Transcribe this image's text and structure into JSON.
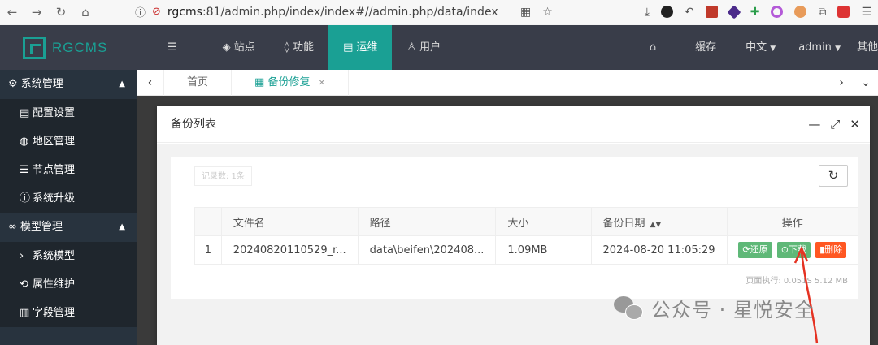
{
  "browser": {
    "url_prefix": "rgcms",
    "url_rest": ":81/admin.php/index/index#//admin.php/data/index"
  },
  "header": {
    "logo": "RGCMS",
    "menu": [
      {
        "icon": "layers-icon",
        "label": "站点",
        "active": false
      },
      {
        "icon": "drop-icon",
        "label": "功能",
        "active": false
      },
      {
        "icon": "ops-icon",
        "label": "运维",
        "active": true
      },
      {
        "icon": "user-icon",
        "label": "用户",
        "active": false
      }
    ],
    "right": {
      "cache": "缓存",
      "lang": "中文",
      "user": "admin",
      "other": "其他"
    }
  },
  "sidebar": {
    "groups": [
      {
        "label": "系统管理",
        "items": [
          "配置设置",
          "地区管理",
          "节点管理",
          "系统升级"
        ]
      },
      {
        "label": "模型管理",
        "items": [
          "系统模型",
          "属性维护",
          "字段管理"
        ]
      }
    ]
  },
  "tabs": {
    "home": "首页",
    "active": "备份修复"
  },
  "modal": {
    "title": "备份列表",
    "record_count": "记录数: 1条",
    "runtime": "页面执行: 0.051S 5.12 MB"
  },
  "table": {
    "headers": [
      "",
      "文件名",
      "路径",
      "大小",
      "备份日期",
      "操作"
    ],
    "rows": [
      {
        "index": "1",
        "filename": "20240820110529_r...",
        "path": "data\\beifen\\202408...",
        "size": "1.09MB",
        "date": "2024-08-20 11:05:29"
      }
    ],
    "actions": {
      "restore": "还原",
      "download": "下载",
      "delete": "删除"
    }
  },
  "watermark": "公众号 · 星悦安全",
  "colors": {
    "accent": "#1aa094",
    "header_bg": "#393d49",
    "sidebar_bg": "#28333e",
    "btn_green": "#5fb878",
    "btn_red": "#ff5722"
  }
}
